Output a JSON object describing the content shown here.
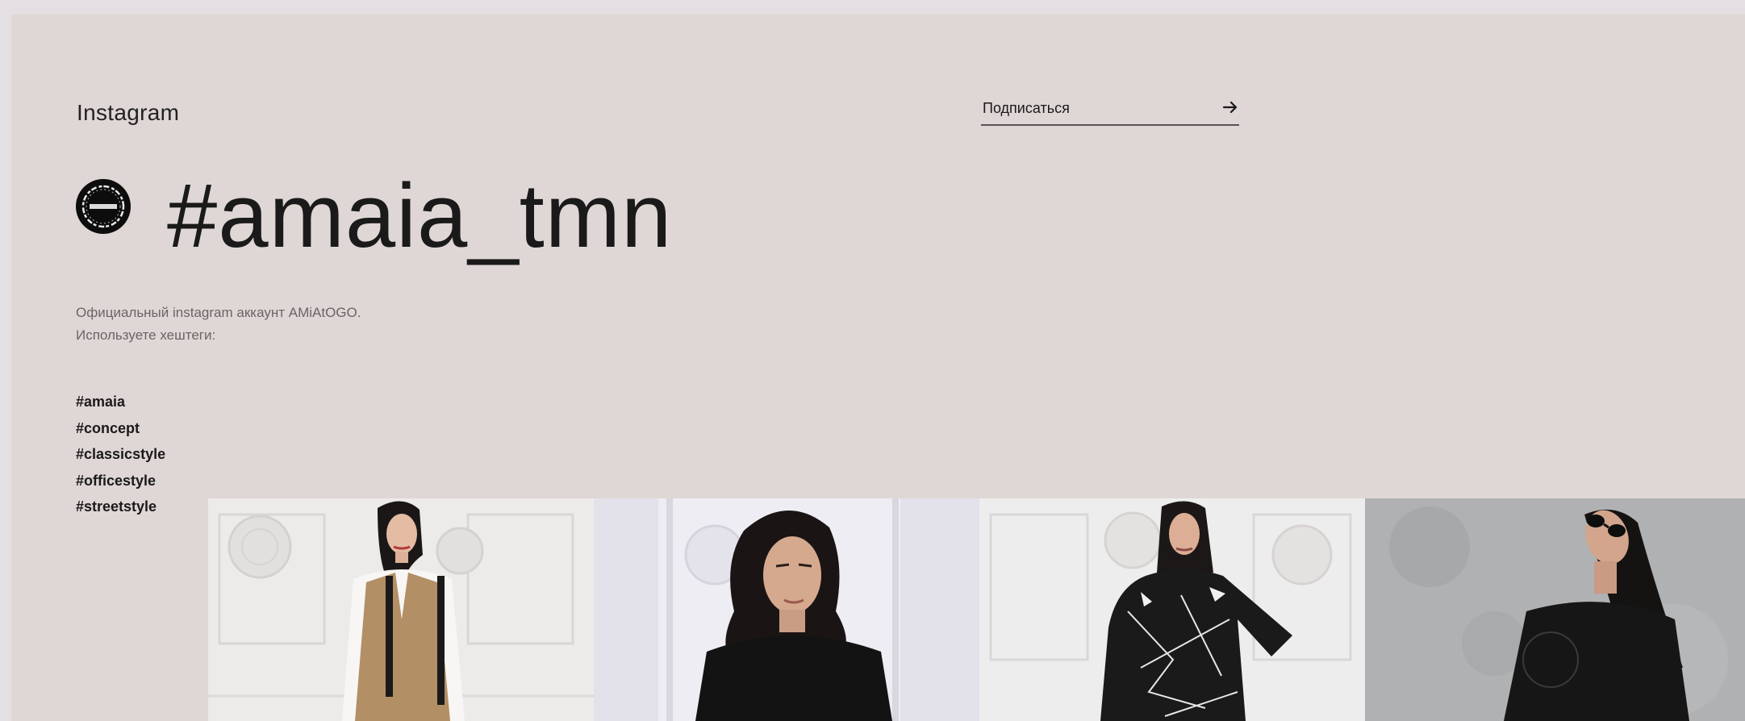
{
  "section": {
    "label": "Instagram"
  },
  "subscribe": {
    "label": "Подписаться",
    "icon": "arrow-right-icon"
  },
  "profile": {
    "handle": "#amaia_tmn",
    "avatar_icon": "amaia-logo-icon"
  },
  "description": {
    "line1": "Официальный instagram аккаунт AMiAtOGO.",
    "line2": "Используете хештеги:"
  },
  "hashtags": [
    "#amaia",
    "#concept",
    "#classicstyle",
    "#officestyle",
    "#streetstyle"
  ],
  "photos": [
    {
      "name": "photo-model-vest"
    },
    {
      "name": "photo-model-portrait"
    },
    {
      "name": "photo-model-printed-dress"
    },
    {
      "name": "photo-model-sunglasses"
    }
  ],
  "colors": {
    "page_background": "#e4dfe3",
    "panel_background": "#dfd7d5",
    "text_primary": "#1a1a1a",
    "text_secondary": "#6a6566"
  }
}
